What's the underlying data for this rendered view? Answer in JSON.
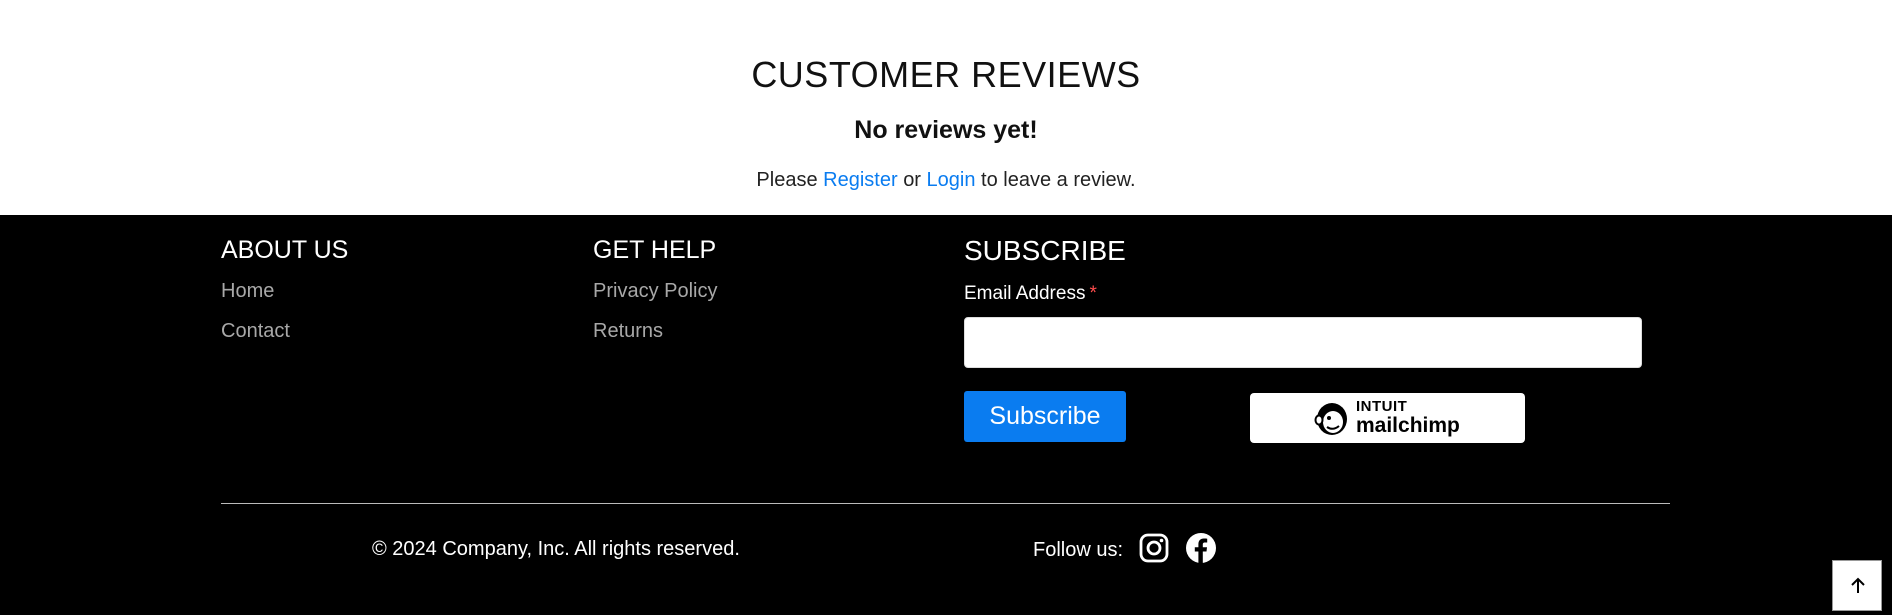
{
  "reviews": {
    "title": "CUSTOMER REVIEWS",
    "empty_message": "No reviews yet!",
    "prompt_prefix": "Please",
    "register_label": "Register",
    "or_text": "or",
    "login_label": "Login",
    "prompt_suffix": "to leave a review.",
    "link_color": "#0a7cf0"
  },
  "footer": {
    "about": {
      "title": "ABOUT US",
      "links": [
        "Home",
        "Contact"
      ]
    },
    "help": {
      "title": "GET HELP",
      "links": [
        "Privacy Policy",
        "Returns"
      ]
    },
    "subscribe": {
      "title": "SUBSCRIBE",
      "email_label": "Email Address",
      "required_mark": "*",
      "email_value": "",
      "button_label": "Subscribe",
      "badge": {
        "line1": "INTUIT",
        "line2": "mailchimp",
        "icon": "mailchimp-freddie-icon"
      },
      "button_color": "#0a7cf0"
    },
    "copyright": "© 2024 Company, Inc. All rights reserved.",
    "follow_label": "Follow us:",
    "social_icons": [
      "instagram-icon",
      "facebook-icon"
    ],
    "back_to_top_icon": "arrow-up-icon"
  }
}
